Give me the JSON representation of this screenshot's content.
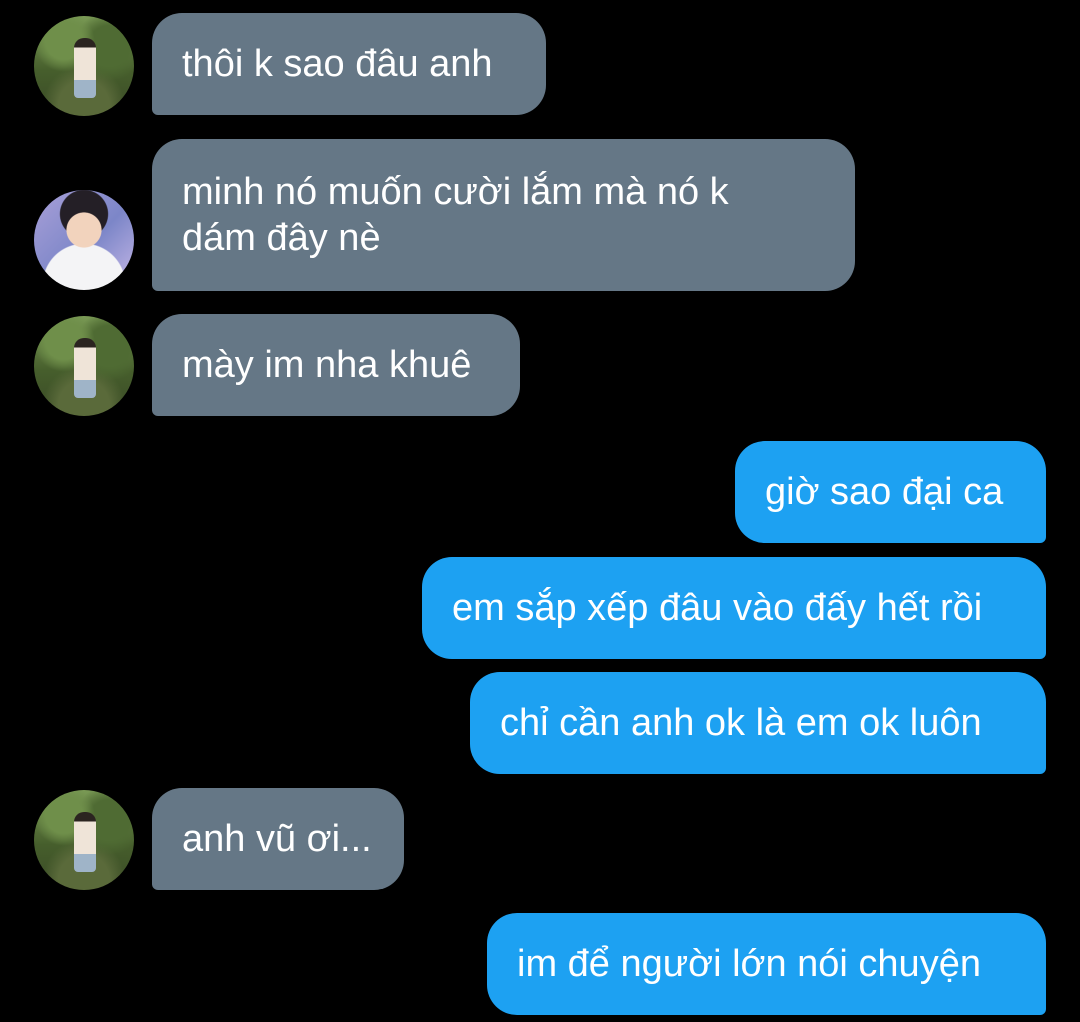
{
  "colors": {
    "background": "#000000",
    "incoming_bubble": "#657786",
    "outgoing_bubble": "#1da1f2",
    "text": "#ffffff"
  },
  "messages": [
    {
      "direction": "incoming",
      "avatar": "avatar-boy-in-park",
      "text": "thôi k sao đâu anh"
    },
    {
      "direction": "incoming",
      "avatar": "avatar-smiling-boy",
      "text": "minh nó muốn cười lắm mà nó k\ndám đây nè"
    },
    {
      "direction": "incoming",
      "avatar": "avatar-boy-in-park",
      "text": "mày im nha khuê"
    },
    {
      "direction": "outgoing",
      "text": "giờ sao đại ca"
    },
    {
      "direction": "outgoing",
      "text": "em sắp xếp đâu vào đấy hết rồi"
    },
    {
      "direction": "outgoing",
      "text": "chỉ cần anh ok là em ok luôn"
    },
    {
      "direction": "incoming",
      "avatar": "avatar-boy-in-park",
      "text": "anh vũ ơi..."
    },
    {
      "direction": "outgoing",
      "text": "im để người lớn nói chuyện"
    }
  ]
}
